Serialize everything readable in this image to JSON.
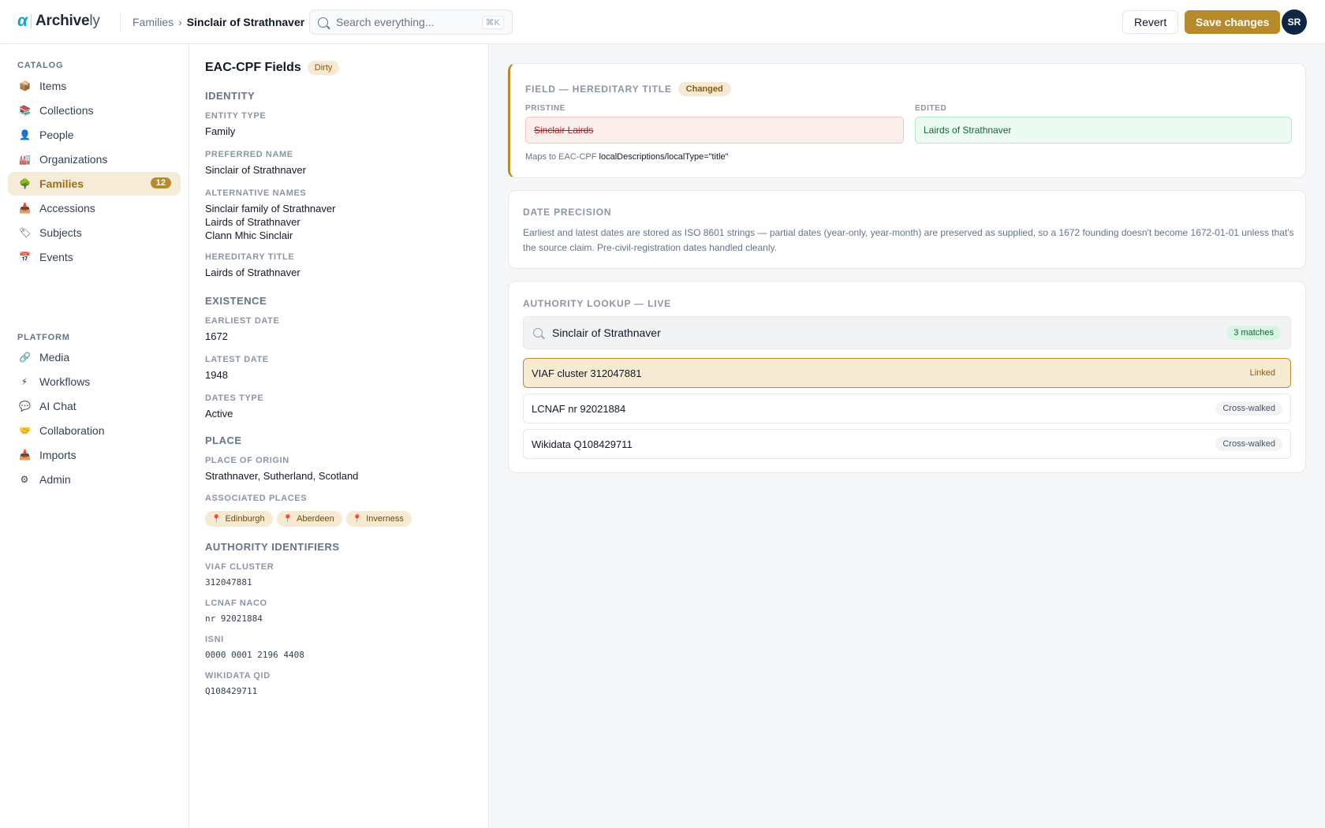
{
  "app": {
    "logo_mark": "α",
    "logo_text_bold": "Archive",
    "logo_text_light": "ly"
  },
  "breadcrumb": {
    "parent": "Families",
    "separator": "›",
    "current": "Sinclair of Strathnaver"
  },
  "search": {
    "placeholder": "Search everything...",
    "shortcut": "⌘K"
  },
  "header_actions": {
    "revert_label": "Revert",
    "save_label": "Save changes",
    "avatar_initials": "SR"
  },
  "sidebar": {
    "catalog_heading": "CATALOG",
    "catalog_items": [
      {
        "label": "Items",
        "icon": "📦",
        "icon_name": "box-icon"
      },
      {
        "label": "Collections",
        "icon": "📚",
        "icon_name": "books-icon"
      },
      {
        "label": "People",
        "icon": "👤",
        "icon_name": "person-icon"
      },
      {
        "label": "Organizations",
        "icon": "🏭",
        "icon_name": "building-icon"
      },
      {
        "label": "Families",
        "icon": "🌳",
        "icon_name": "tree-icon",
        "badge": "12",
        "active": true
      },
      {
        "label": "Accessions",
        "icon": "📥",
        "icon_name": "inbox-icon"
      },
      {
        "label": "Subjects",
        "icon": "🏷",
        "icon_name": "tag-icon"
      },
      {
        "label": "Events",
        "icon": "📅",
        "icon_name": "calendar-icon"
      }
    ],
    "platform_heading": "PLATFORM",
    "platform_items": [
      {
        "label": "Media",
        "icon": "🔗",
        "icon_name": "link-icon"
      },
      {
        "label": "Workflows",
        "icon": "⚡",
        "icon_name": "lightning-icon"
      },
      {
        "label": "AI Chat",
        "icon": "💬",
        "icon_name": "chat-icon"
      },
      {
        "label": "Collaboration",
        "icon": "🤝",
        "icon_name": "handshake-icon"
      },
      {
        "label": "Imports",
        "icon": "📥",
        "icon_name": "import-icon"
      },
      {
        "label": "Admin",
        "icon": "⚙",
        "icon_name": "gear-icon"
      }
    ]
  },
  "fields": {
    "title": "EAC-CPF Fields",
    "status": "Dirty",
    "identity_heading": "IDENTITY",
    "entity_type_label": "ENTITY TYPE",
    "entity_type": "Family",
    "preferred_name_label": "PREFERRED NAME",
    "preferred_name": "Sinclair of Strathnaver",
    "alternative_names_label": "ALTERNATIVE NAMES",
    "alternative_names": [
      "Sinclair family of Strathnaver",
      "Lairds of Strathnaver",
      "Clann Mhic Sinclair"
    ],
    "hereditary_title_label": "HEREDITARY TITLE",
    "hereditary_title": "Lairds of Strathnaver",
    "existence_heading": "EXISTENCE",
    "earliest_date_label": "EARLIEST DATE",
    "earliest_date": "1672",
    "latest_date_label": "LATEST DATE",
    "latest_date": "1948",
    "dates_type_label": "DATES TYPE",
    "dates_type": "Active",
    "place_heading": "PLACE",
    "place_of_origin_label": "PLACE OF ORIGIN",
    "place_of_origin": "Strathnaver, Sutherland, Scotland",
    "associated_places_label": "ASSOCIATED PLACES",
    "associated_places": [
      "Edinburgh",
      "Aberdeen",
      "Inverness"
    ],
    "authority_heading": "AUTHORITY IDENTIFIERS",
    "viaf_label": "VIAF CLUSTER",
    "viaf": "312047881",
    "lcnaf_label": "LCNAF NACO",
    "lcnaf": "nr 92021884",
    "isni_label": "ISNI",
    "isni": "0000 0001 2196 4408",
    "wikidata_label": "WIKIDATA QID",
    "wikidata": "Q108429711"
  },
  "diff_card": {
    "heading": "FIELD — HEREDITARY TITLE",
    "status": "Changed",
    "pristine_label": "PRISTINE",
    "pristine_value": "Sinclair Lairds",
    "edited_label": "EDITED",
    "edited_value": "Lairds of Strathnaver",
    "maps_prefix": "Maps to EAC-CPF",
    "maps_path": "localDescriptions/localType=\"title\""
  },
  "date_card": {
    "heading": "DATE PRECISION",
    "body": "Earliest and latest dates are stored as ISO 8601 strings — partial dates (year-only, year-month) are preserved as supplied, so a 1672 founding doesn't become 1672-01-01 unless that's the source claim. Pre-civil-registration dates handled cleanly."
  },
  "authority_card": {
    "heading": "AUTHORITY LOOKUP — LIVE",
    "query": "Sinclair of Strathnaver",
    "match_count": "3 matches",
    "matches": [
      {
        "label": "VIAF cluster 312047881",
        "status": "Linked"
      },
      {
        "label": "LCNAF nr 92021884",
        "status": "Cross-walked"
      },
      {
        "label": "Wikidata Q108429711",
        "status": "Cross-walked"
      }
    ]
  },
  "colors": {
    "accent": "#b78a2c",
    "brand": "#0ea5c9",
    "pristine_bg": "#fdeeee",
    "edited_bg": "#ecfbf1"
  }
}
